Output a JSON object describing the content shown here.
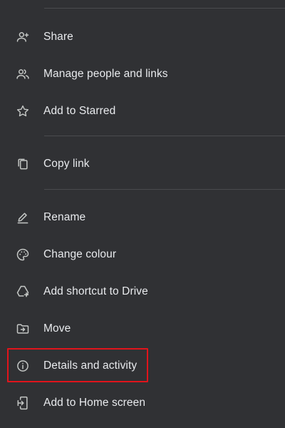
{
  "menu": {
    "items": [
      {
        "label": "Share",
        "icon": "person-add-icon"
      },
      {
        "label": "Manage people and links",
        "icon": "people-icon"
      },
      {
        "label": "Add to Starred",
        "icon": "star-outline-icon"
      },
      {
        "label": "Copy link",
        "icon": "copy-icon"
      },
      {
        "label": "Rename",
        "icon": "edit-pencil-icon"
      },
      {
        "label": "Change colour",
        "icon": "palette-icon"
      },
      {
        "label": "Add shortcut to Drive",
        "icon": "drive-shortcut-icon"
      },
      {
        "label": "Move",
        "icon": "folder-move-icon"
      },
      {
        "label": "Details and activity",
        "icon": "info-icon"
      },
      {
        "label": "Add to Home screen",
        "icon": "add-to-home-screen-icon"
      }
    ]
  },
  "colors": {
    "background": "#303134",
    "text": "#e8eaed",
    "icon": "#c4c7c5",
    "divider": "#4a4b4e",
    "highlight": "#e1141b"
  }
}
